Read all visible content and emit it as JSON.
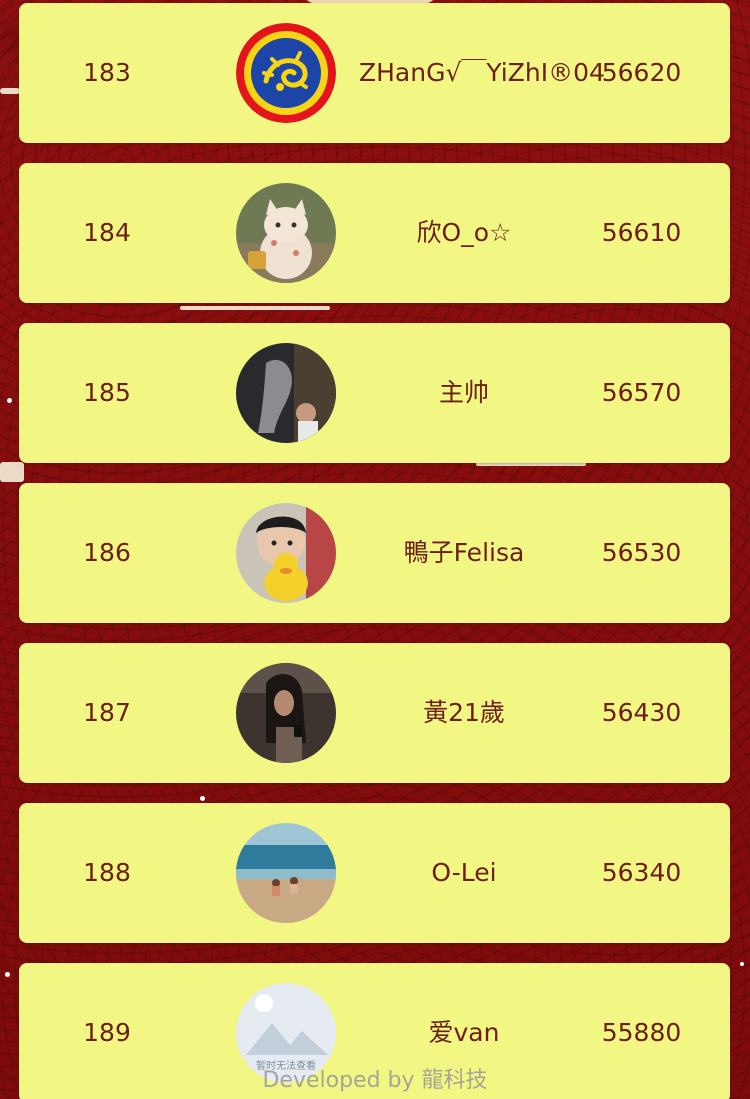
{
  "leaderboard": {
    "rows": [
      {
        "rank": "183",
        "name": "ZHanG√￣YiZhI®04",
        "score": "56620",
        "avatar": "dragon-emblem-avatar"
      },
      {
        "rank": "184",
        "name": "欣O_o☆",
        "score": "56610",
        "avatar": "lucky-cat-avatar"
      },
      {
        "rank": "185",
        "name": "主帅",
        "score": "56570",
        "avatar": "dark-photo-avatar"
      },
      {
        "rank": "186",
        "name": "鴨子Felisa",
        "score": "56530",
        "avatar": "child-with-duck-avatar"
      },
      {
        "rank": "187",
        "name": "黃21歲",
        "score": "56430",
        "avatar": "girl-with-phone-avatar"
      },
      {
        "rank": "188",
        "name": "O-Lei",
        "score": "56340",
        "avatar": "beach-photo-avatar"
      },
      {
        "rank": "189",
        "name": "爱van",
        "score": "55880",
        "avatar": "image-unavailable-avatar",
        "avatar_caption": "暂时无法查看"
      }
    ]
  },
  "footer": {
    "text": "Developed by 龍科技"
  },
  "colors": {
    "background": "#8a0e0e",
    "card": "#f2f784",
    "text": "#6d1e16"
  }
}
